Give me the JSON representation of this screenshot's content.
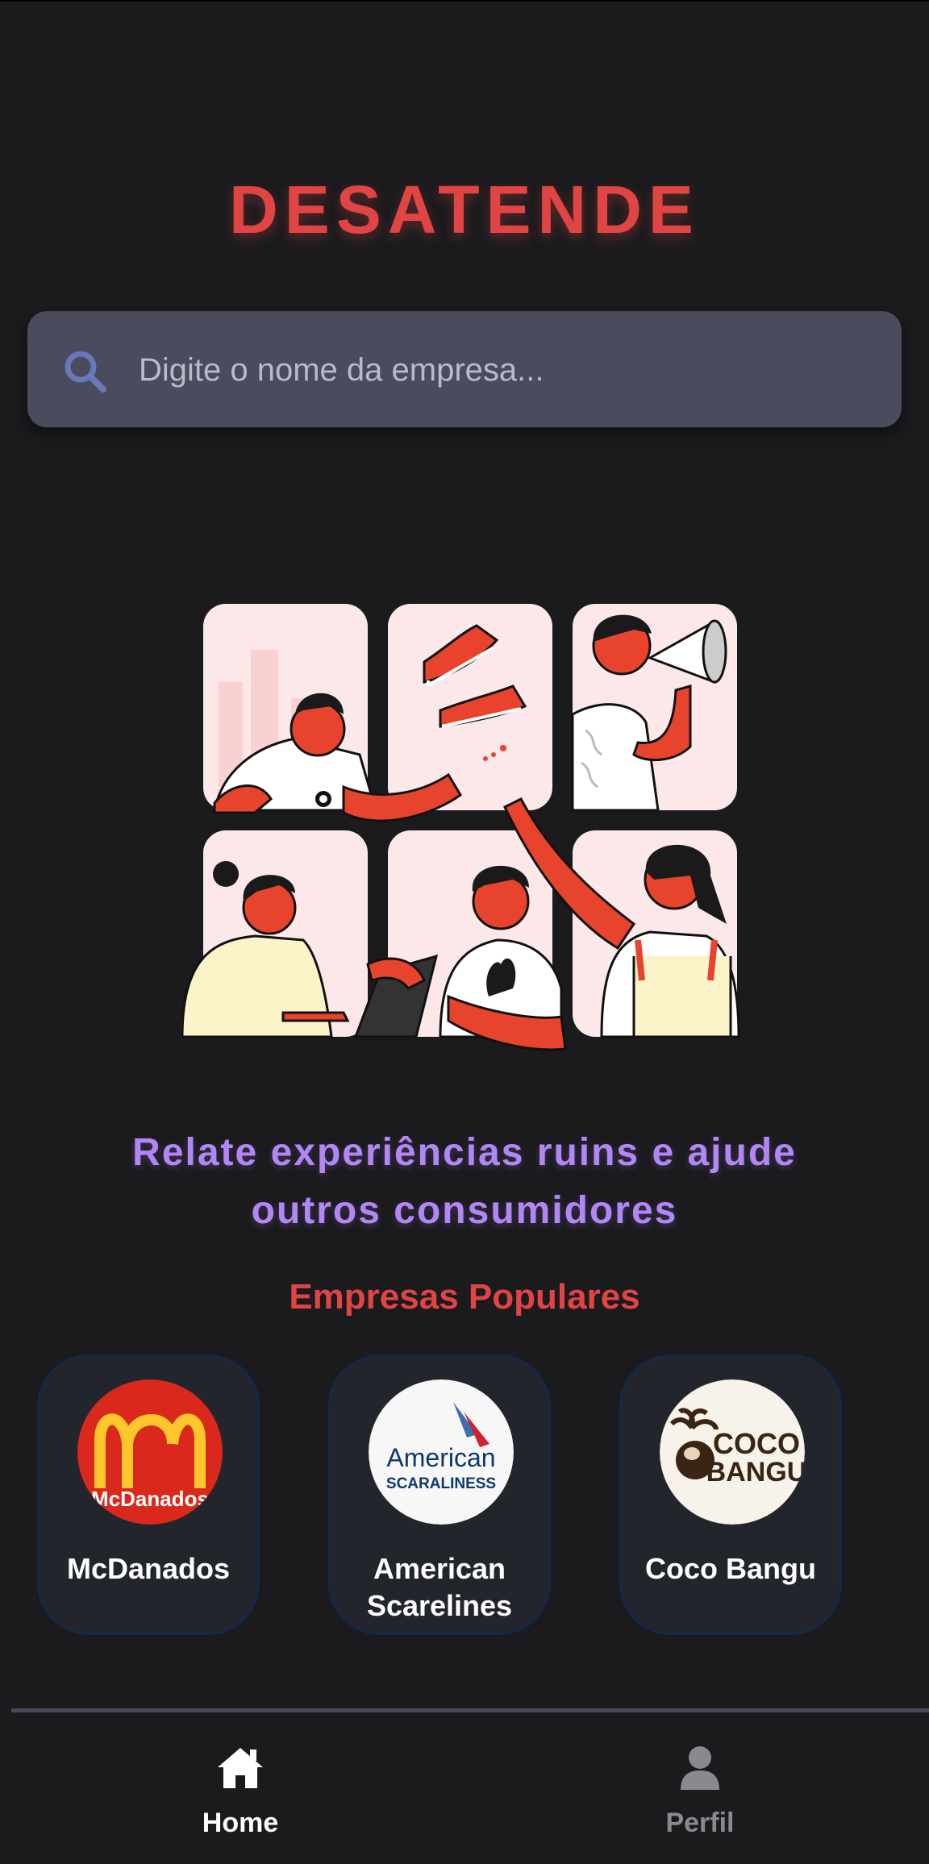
{
  "app": {
    "title": "DESATENDE"
  },
  "search": {
    "placeholder": "Digite o nome da empresa...",
    "value": ""
  },
  "hero": {
    "tagline": "Relate experiências ruins e ajude outros consumidores"
  },
  "popular": {
    "title": "Empresas Populares",
    "companies": [
      {
        "name": "McDanados",
        "logo_text": "McDanados",
        "icon": "mcdanados-logo"
      },
      {
        "name": "American Scarelines",
        "logo_text_1": "American",
        "logo_text_2": "SCARALINESS",
        "icon": "american-scarelines-logo"
      },
      {
        "name": "Coco Bangu",
        "logo_text_1": "COCO",
        "logo_text_2": "BANGU",
        "icon": "coco-bangu-logo"
      }
    ]
  },
  "nav": {
    "items": [
      {
        "label": "Home",
        "icon": "home-icon",
        "active": true
      },
      {
        "label": "Perfil",
        "icon": "user-icon",
        "active": false
      }
    ]
  },
  "colors": {
    "background": "#1b1b1e",
    "brand_red": "#e04443",
    "accent_purple": "#b286f5",
    "search_bg": "#4a4c5e",
    "card_bg": "#22252b",
    "card_border": "#14284a",
    "nav_inactive": "#8a8a8e"
  }
}
